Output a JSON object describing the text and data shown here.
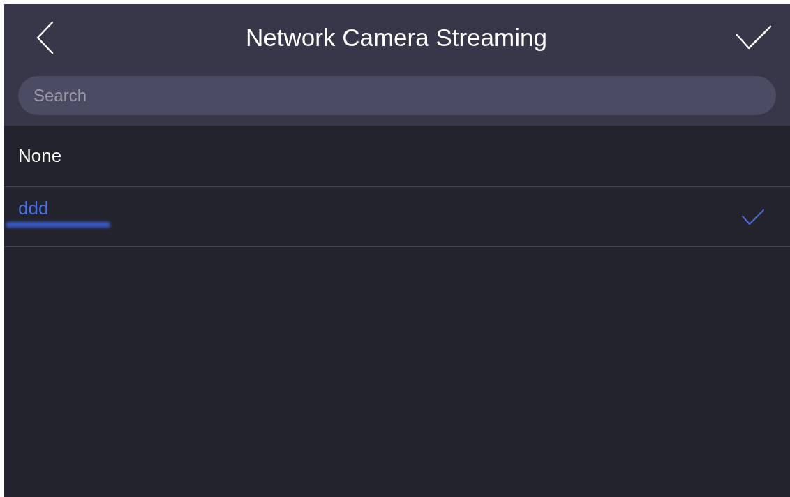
{
  "header": {
    "title": "Network Camera Streaming"
  },
  "search": {
    "placeholder": "Search"
  },
  "items": [
    {
      "label": "None",
      "selected": false
    },
    {
      "label": "ddd",
      "selected": true
    }
  ]
}
